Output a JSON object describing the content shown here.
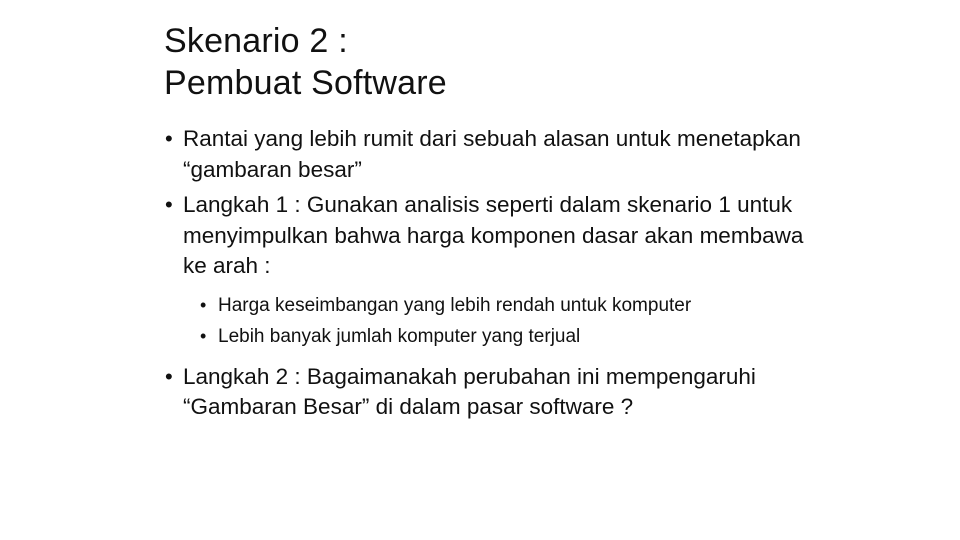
{
  "slide": {
    "title_lines": [
      "Skenario 2 :",
      "Pembuat Software"
    ],
    "bullets": [
      {
        "text": "Rantai yang lebih rumit dari sebuah alasan untuk menetapkan “gambaran besar”"
      },
      {
        "text": "Langkah 1 : Gunakan analisis seperti dalam skenario 1 untuk menyimpulkan bahwa harga komponen dasar akan membawa ke arah :",
        "sub_bullets": [
          "Harga keseimbangan yang lebih rendah untuk komputer",
          "Lebih banyak jumlah komputer yang terjual"
        ]
      },
      {
        "text": "Langkah 2 : Bagaimanakah perubahan ini mempengaruhi “Gambaran Besar” di dalam pasar software ?"
      }
    ],
    "bullet_glyph": "•"
  }
}
